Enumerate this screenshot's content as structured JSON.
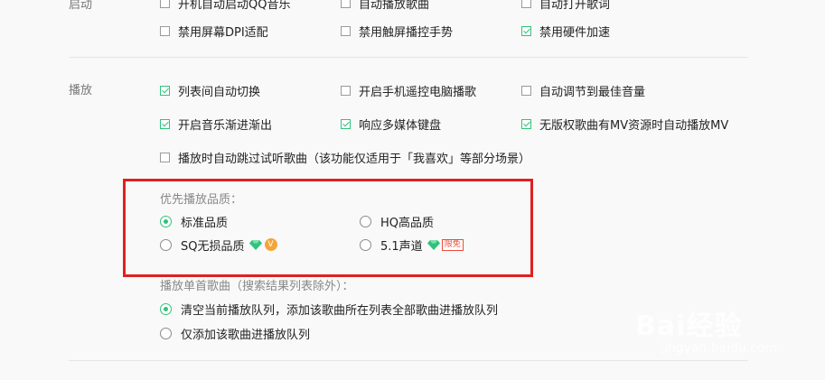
{
  "sections": {
    "startup_label": "启动",
    "playback_label": "播放"
  },
  "startup": [
    {
      "label": "开机自动启动QQ音乐",
      "checked": false
    },
    {
      "label": "自动播放歌曲",
      "checked": false
    },
    {
      "label": "自动打开歌词",
      "checked": false
    },
    {
      "label": "禁用屏幕DPI适配",
      "checked": false
    },
    {
      "label": "禁用触屏播控手势",
      "checked": false
    },
    {
      "label": "禁用硬件加速",
      "checked": true
    }
  ],
  "playback": [
    {
      "label": "列表间自动切换",
      "checked": true
    },
    {
      "label": "开启手机遥控电脑播歌",
      "checked": false
    },
    {
      "label": "自动调节到最佳音量",
      "checked": false
    },
    {
      "label": "开启音乐渐进渐出",
      "checked": true
    },
    {
      "label": "响应多媒体键盘",
      "checked": true
    },
    {
      "label": "无版权歌曲有MV资源时自动播放MV",
      "checked": true
    },
    {
      "label": "播放时自动跳过试听歌曲（该功能仅适用于「我喜欢」等部分场景）",
      "checked": false
    }
  ],
  "quality": {
    "title": "优先播放品质：",
    "options": [
      {
        "label": "标准品质",
        "selected": true
      },
      {
        "label": "HQ高品质",
        "selected": false
      },
      {
        "label": "SQ无损品质",
        "selected": false
      },
      {
        "label": "5.1声道",
        "selected": false
      }
    ],
    "limited_badge": "限免",
    "vip_badge": "V"
  },
  "single_play": {
    "title": "播放单首歌曲（搜索结果列表除外）：",
    "options": [
      {
        "label": "清空当前播放队列，添加该歌曲所在列表全部歌曲进播放队列",
        "selected": true
      },
      {
        "label": "仅添加该歌曲进播放队列",
        "selected": false
      }
    ]
  },
  "colors": {
    "accent": "#31c27c",
    "highlight_box": "#e02020"
  },
  "watermark": {
    "brand": "Bai经验",
    "url": "jingyan.baidu.com"
  }
}
